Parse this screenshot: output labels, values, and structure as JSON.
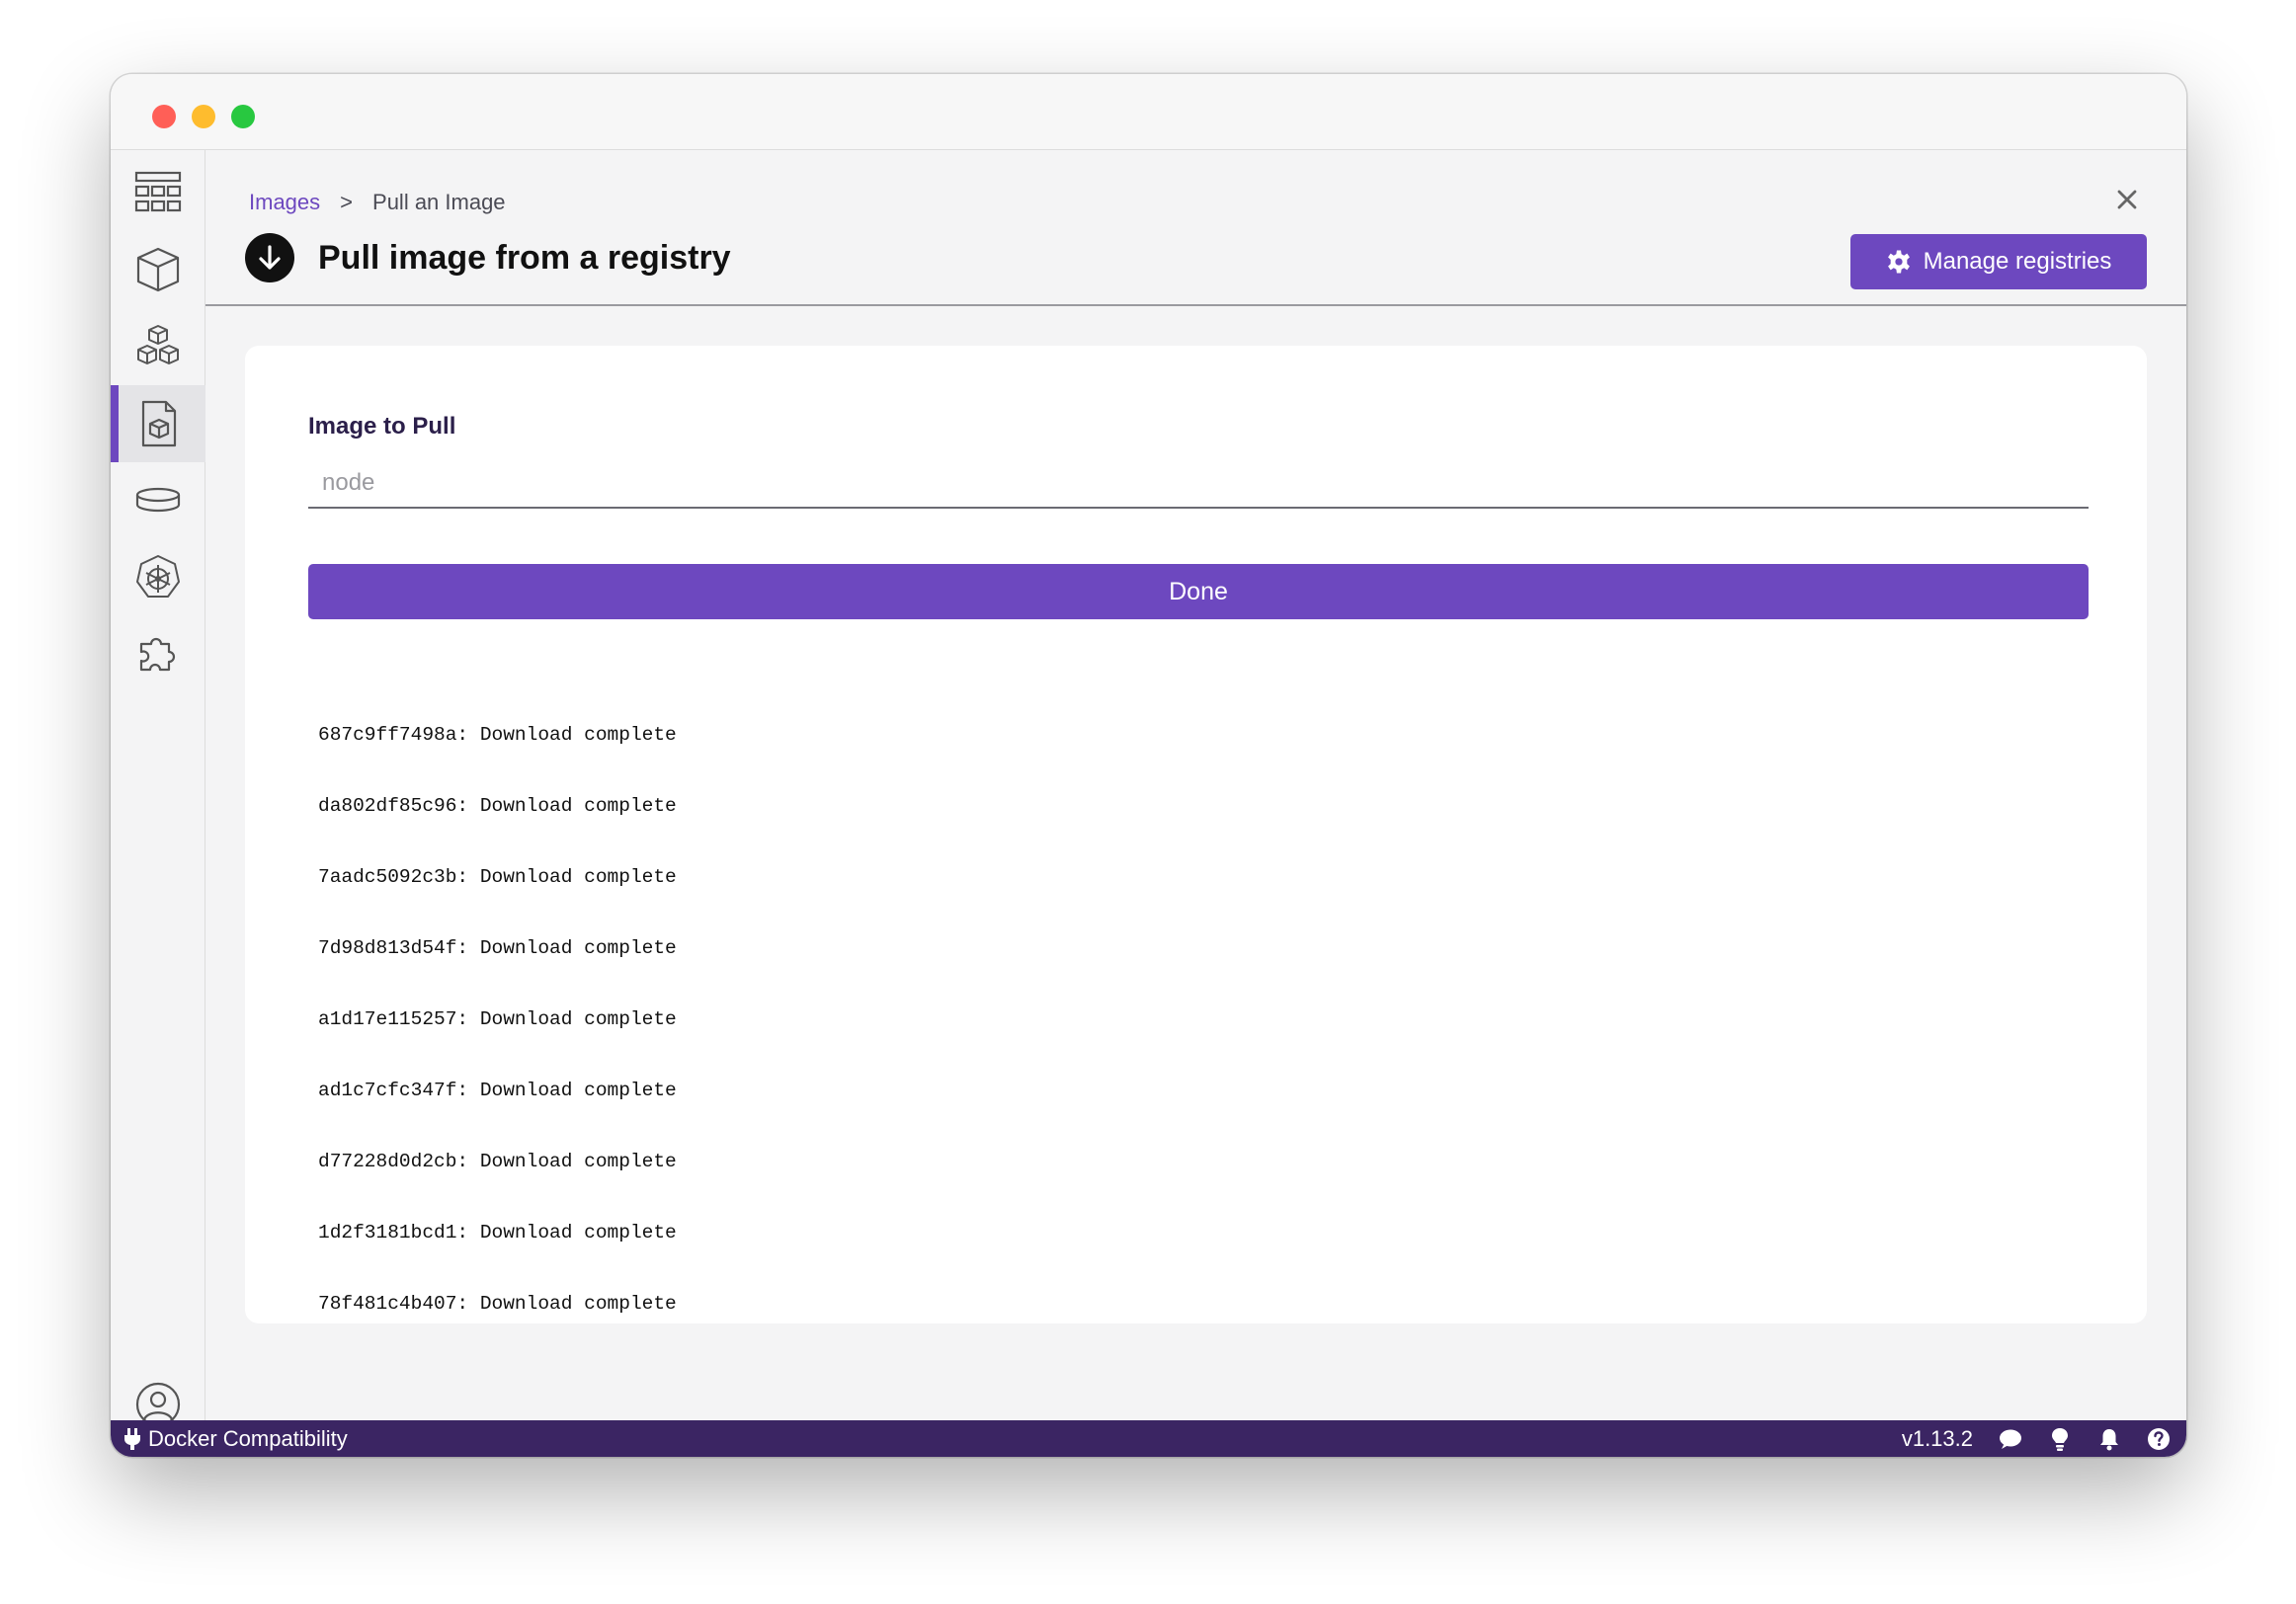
{
  "breadcrumb": {
    "parent": "Images",
    "separator": ">",
    "current": "Pull an Image"
  },
  "header": {
    "title": "Pull image from a registry",
    "manage_label": "Manage registries"
  },
  "form": {
    "label": "Image to Pull",
    "placeholder": "node",
    "value": ""
  },
  "done_label": "Done",
  "log_lines": [
    "687c9ff7498a: Download complete",
    "da802df85c96: Download complete",
    "7aadc5092c3b: Download complete",
    "7d98d813d54f: Download complete",
    "a1d17e115257: Download complete",
    "ad1c7cfc347f: Download complete",
    "d77228d0d2cb: Download complete",
    "1d2f3181bcd1: Download complete",
    "78f481c4b407: Download complete"
  ],
  "statusbar": {
    "mode": "Docker Compatibility",
    "version": "v1.13.2"
  },
  "sidebar": {
    "items": [
      {
        "icon": "dashboard-icon",
        "active": false
      },
      {
        "icon": "containers-icon",
        "active": false
      },
      {
        "icon": "pods-icon",
        "active": false
      },
      {
        "icon": "images-icon",
        "active": true
      },
      {
        "icon": "volumes-icon",
        "active": false
      },
      {
        "icon": "kubernetes-icon",
        "active": false
      },
      {
        "icon": "extensions-icon",
        "active": false
      },
      {
        "icon": "account-icon",
        "active": false
      },
      {
        "icon": "settings-icon",
        "active": false
      }
    ]
  },
  "colors": {
    "accent": "#6d48bf",
    "statusbar": "#3b2563"
  }
}
